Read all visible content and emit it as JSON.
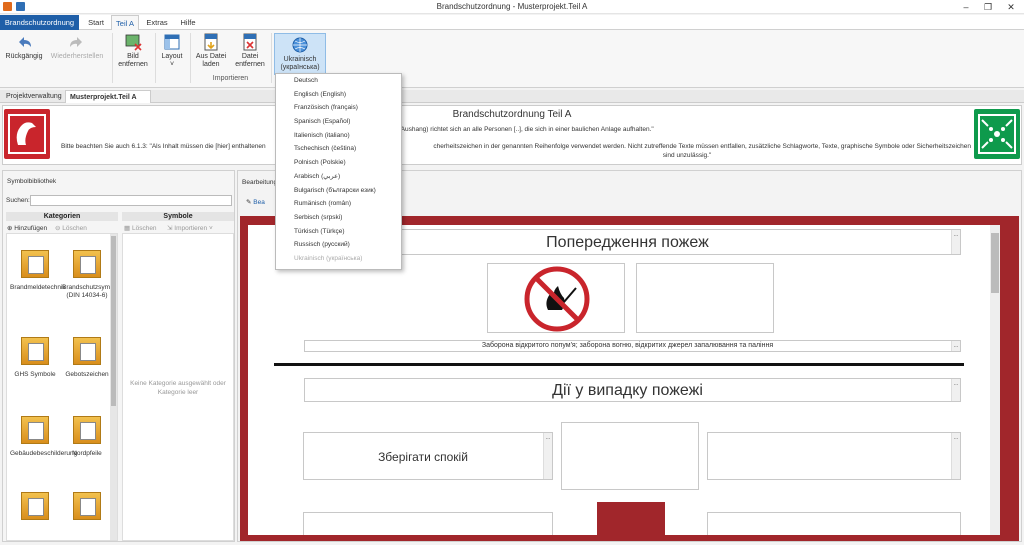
{
  "window": {
    "title": "Brandschutzordnung - Musterprojekt.Teil A"
  },
  "ribbon_tabs": {
    "file": "Brandschutzordnung",
    "tabs": [
      "Start",
      "Teil A",
      "Extras",
      "Hilfe"
    ]
  },
  "ribbon": {
    "undo": "Rückgängig",
    "redo": "Wiederherstellen",
    "remove_image": "Bild entfernen",
    "layout": "Layout",
    "load_file": "Aus Datei laden",
    "remove_file": "Datei entfernen",
    "import_group": "Importieren",
    "language": "Ukrainisch (українська)"
  },
  "doc_tabs": [
    "Projektverwaltung",
    "Musterprojekt.Teil A"
  ],
  "header": {
    "title": "Brandschutzordnung Teil A",
    "line1": "\"[..] Teil A (Aushang) richtet sich an alle Personen [..], die sich in einer baulichen Anlage aufhalten.\"",
    "line2_left": "Bitte beachten Sie auch 6.1.3: \"Als Inhalt müssen die [hier] enthaltenen",
    "line2_right": "cherheitszeichen in der genannten Reihenfolge verwendet werden. Nicht zutreffende Texte müssen entfallen, zusätzliche Schlagworte, Texte, graphische Symbole oder Sicherheitszeichen",
    "line3": "sind unzulässig.\""
  },
  "symbol_library": {
    "title": "Symbolbibliothek",
    "search_label": "Suchen:",
    "search_value": "",
    "categories_header": "Kategorien",
    "symbols_header": "Symbole",
    "add": "Hinzufügen",
    "delete": "Löschen",
    "sym_delete": "Löschen",
    "sym_import": "Importieren",
    "empty_text": "Keine Kategorie ausgewählt oder Kategorie leer",
    "categories": [
      "Brandmeldetechnik",
      "Brandschutzsymbole (DIN 14034-6)",
      "GHS Symbole",
      "Gebotszeichen",
      "Gebäudebeschilderung",
      "Nordpfeile",
      "",
      ""
    ]
  },
  "editor": {
    "label": "Bearbeitung",
    "edit_btn": "Bea",
    "heading1": "Попередження пожеж",
    "caption1": "Заборона відкритого попум'я; заборона вогню, відкритих джерел запалювання та паління",
    "heading2": "Дії у випадку пожежі",
    "action1": "Зберігати спокій",
    "dots": "..."
  },
  "language_menu": [
    "Deutsch",
    "Englisch (English)",
    "Französisch (français)",
    "Spanisch (Español)",
    "Italienisch (italiano)",
    "Tschechisch (čeština)",
    "Polnisch (Polskie)",
    "Arabisch (عربي)",
    "Bulgarisch (български език)",
    "Rumänisch (român)",
    "Serbisch (srpski)",
    "Türkisch (Türkçe)",
    "Russisch (русский)",
    "Ukrainisch (українська)"
  ],
  "colors": {
    "accent": "#1f5fa8",
    "frame": "#a1262b",
    "fire": "#c9252c",
    "exit": "#0e9a4c"
  }
}
